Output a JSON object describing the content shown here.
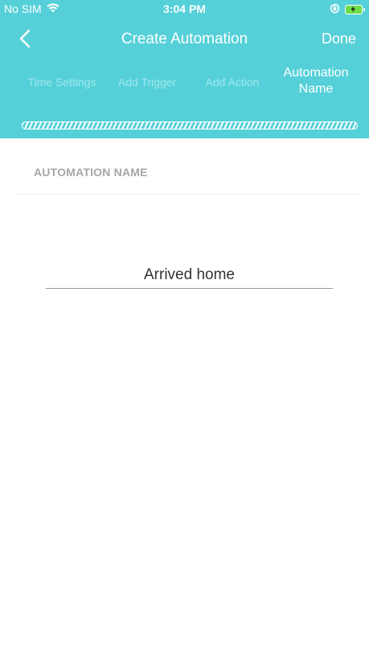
{
  "status_bar": {
    "carrier": "No SIM",
    "time": "3:04 PM"
  },
  "nav": {
    "title": "Create Automation",
    "done_label": "Done"
  },
  "steps": [
    {
      "label": "Time Settings"
    },
    {
      "label": "Add Trigger"
    },
    {
      "label": "Add Action"
    },
    {
      "label_line1": "Automation",
      "label_line2": "Name"
    }
  ],
  "form": {
    "section_label": "AUTOMATION NAME",
    "name_value": "Arrived home"
  },
  "colors": {
    "header_bg": "#55d0d8",
    "inactive_step": "#9fe8ec",
    "label_gray": "#a6a6a6"
  },
  "icons": {
    "back": "chevron-left-icon",
    "wifi": "wifi-icon",
    "rotation_lock": "rotation-lock-icon",
    "battery": "battery-charging-icon"
  }
}
